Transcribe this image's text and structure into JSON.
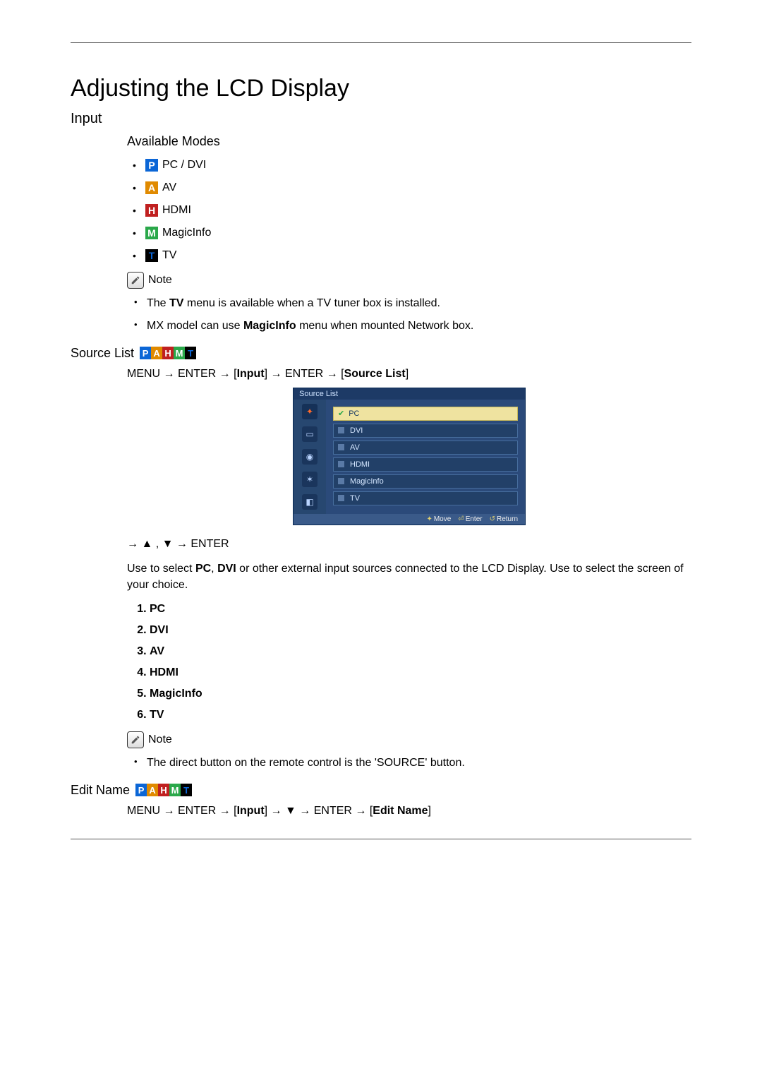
{
  "title": "Adjusting the LCD Display",
  "sections": {
    "input": {
      "heading": "Input",
      "available_modes": {
        "heading": "Available Modes",
        "items": [
          {
            "letter": "P",
            "label": "PC / DVI"
          },
          {
            "letter": "A",
            "label": "AV"
          },
          {
            "letter": "H",
            "label": "HDMI"
          },
          {
            "letter": "M",
            "label": "MagicInfo"
          },
          {
            "letter": "T",
            "label": "TV"
          }
        ]
      },
      "note1": {
        "label": "Note",
        "items": [
          "The TV menu is available when a TV tuner box is installed.",
          "MX model can use MagicInfo menu when mounted Network box."
        ],
        "bold_terms": {
          "tv": "TV",
          "magicinfo": "MagicInfo"
        }
      }
    },
    "source_list": {
      "heading": "Source List ",
      "pahmt": [
        "P",
        "A",
        "H",
        "M",
        "T"
      ],
      "menu_path": {
        "text_parts": [
          "MENU → ENTER → [",
          "Input",
          "] → ENTER → [",
          "Source List",
          "]"
        ]
      },
      "osd": {
        "title": "Source List",
        "items": [
          "PC",
          "DVI",
          "AV",
          "HDMI",
          "MagicInfo",
          "TV"
        ],
        "footer": {
          "move": "Move",
          "enter": "Enter",
          "return": "Return"
        }
      },
      "arrows_line": "→ ▲ , ▼ → ENTER",
      "description_prefix": "Use to select ",
      "description_bold1": "PC",
      "description_mid": ", ",
      "description_bold2": "DVI",
      "description_suffix": " or other external input sources connected to the LCD Display. Use to select the screen of your choice.",
      "list": [
        "PC",
        "DVI",
        "AV",
        "HDMI",
        "MagicInfo",
        "TV"
      ],
      "note2": {
        "label": "Note",
        "items": [
          "The direct button on the remote control is the 'SOURCE' button."
        ]
      }
    },
    "edit_name": {
      "heading": "Edit Name",
      "pahmt": [
        "P",
        "A",
        "H",
        "M",
        "T"
      ],
      "menu_path": {
        "text_parts": [
          "MENU → ENTER → [",
          "Input",
          "] → ▼ → ENTER → [",
          "Edit Name",
          "]"
        ]
      }
    }
  },
  "colors": {
    "p": "#0b66d6",
    "a": "#e08a00",
    "h": "#c02020",
    "m": "#2aa84a",
    "t": "#000000"
  }
}
